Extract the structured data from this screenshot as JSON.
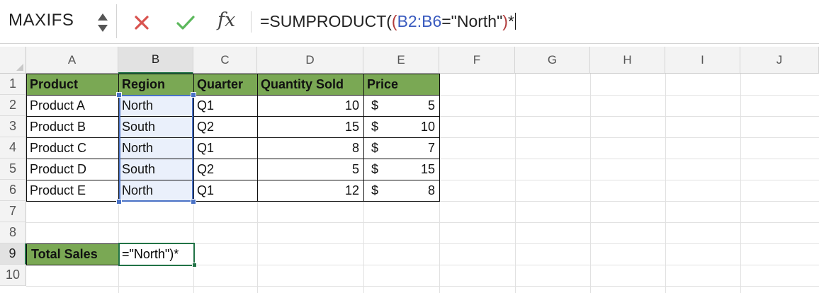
{
  "name_box": {
    "value": "MAXIFS"
  },
  "formula_bar": {
    "fx_label": "fx",
    "parts": [
      {
        "text": "=SUMPRODUCT(",
        "kind": "plain"
      },
      {
        "text": "(",
        "kind": "paren"
      },
      {
        "text": "B2:B6",
        "kind": "ref"
      },
      {
        "text": "=\"North\"",
        "kind": "plain"
      },
      {
        "text": ")",
        "kind": "paren"
      },
      {
        "text": "*",
        "kind": "plain"
      }
    ]
  },
  "colors": {
    "header_green": "#7aa854",
    "selection_blue": "#4a72c6",
    "active_green": "#217346",
    "ref_blue": "#3a5bbf",
    "paren_red": "#b13a3a",
    "cancel_red": "#d9534f",
    "enter_green": "#5cb85c"
  },
  "columns": [
    "A",
    "B",
    "C",
    "D",
    "E",
    "F",
    "G",
    "H",
    "I",
    "J"
  ],
  "rows": [
    "1",
    "2",
    "3",
    "4",
    "5",
    "6",
    "7",
    "8",
    "9",
    "10"
  ],
  "active_column": "B",
  "active_row": "9",
  "table": {
    "headers": [
      "Product",
      "Region",
      "Quarter",
      "Quantity Sold",
      "Price"
    ],
    "rows": [
      [
        "Product A",
        "North",
        "Q1",
        "10",
        "$",
        "5"
      ],
      [
        "Product B",
        "South",
        "Q2",
        "15",
        "$",
        "10"
      ],
      [
        "Product C",
        "North",
        "Q1",
        "8",
        "$",
        "7"
      ],
      [
        "Product D",
        "South",
        "Q2",
        "5",
        "$",
        "15"
      ],
      [
        "Product E",
        "North",
        "Q1",
        "12",
        "$",
        "8"
      ]
    ]
  },
  "total": {
    "label": "Total Sales",
    "editing_value": "=\"North\")*"
  }
}
